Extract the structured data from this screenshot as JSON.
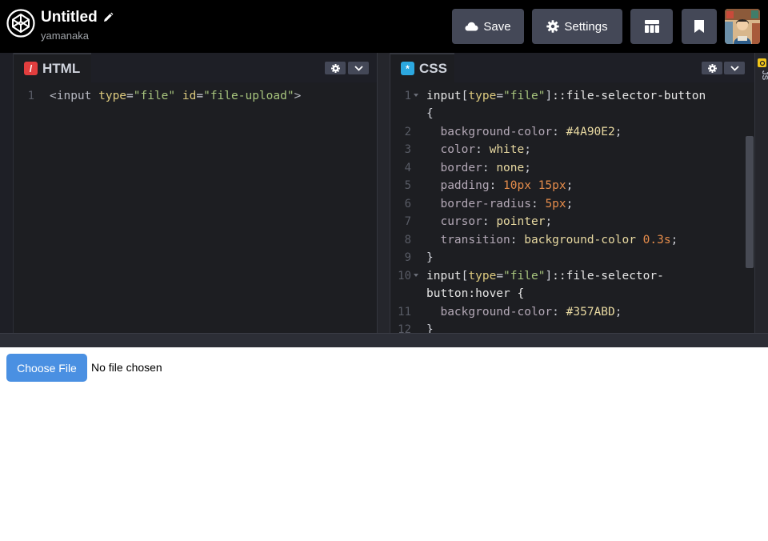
{
  "header": {
    "title": "Untitled",
    "owner": "yamanaka",
    "save_label": "Save",
    "settings_label": "Settings",
    "icons": [
      "codepen-logo-icon",
      "pencil-icon",
      "cloud-icon",
      "gear-icon",
      "layout-icon",
      "pin-icon"
    ]
  },
  "html_pane": {
    "tab_label": "HTML",
    "tab_icon_glyph": "/",
    "tab_icon_color": "#e23e3e",
    "lines": [
      {
        "n": "1",
        "text": "<input type=\"file\" id=\"file-upload\">"
      }
    ]
  },
  "css_pane": {
    "tab_label": "CSS",
    "tab_icon_glyph": "*",
    "tab_icon_color": "#2ca8e0",
    "line_numbers": [
      "1",
      "2",
      "3",
      "4",
      "5",
      "6",
      "7",
      "8",
      "9",
      "10",
      "11",
      "12"
    ],
    "code": [
      "input[type=\"file\"]::file-selector-button",
      "{",
      "  background-color: #4A90E2;",
      "  color: white;",
      "  border: none;",
      "  padding: 10px 15px;",
      "  border-radius: 5px;",
      "  cursor: pointer;",
      "  transition: background-color 0.3s;",
      "}",
      "input[type=\"file\"]::file-selector-",
      "button:hover {",
      "  background-color: #357ABD;",
      "}"
    ]
  },
  "js_pane": {
    "badge": "JS",
    "label": "JS"
  },
  "preview": {
    "choose_file_label": "Choose File",
    "no_file_label": "No file chosen",
    "button_color": "#4A90E2"
  }
}
